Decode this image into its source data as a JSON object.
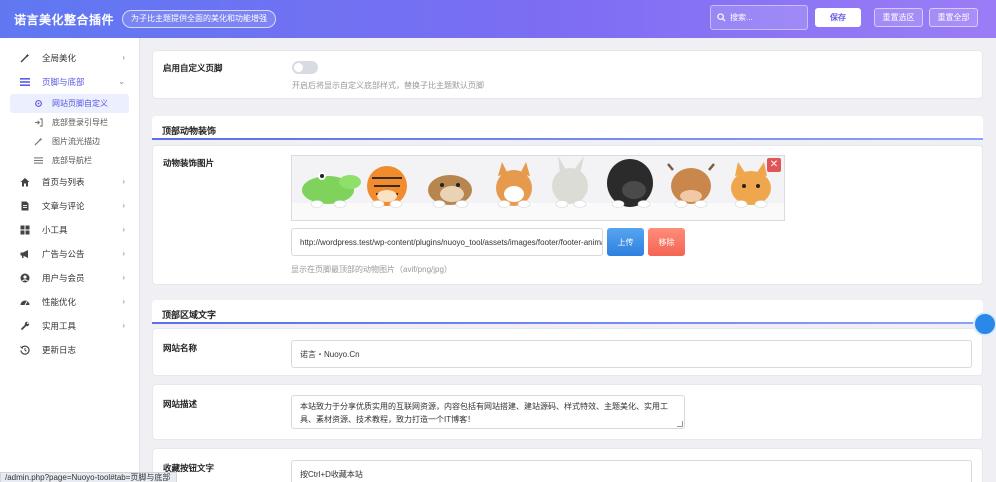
{
  "header": {
    "title": "诺言美化整合插件",
    "tagline": "为子比主题提供全面的美化和功能增强",
    "search_placeholder": "搜索...",
    "save_label": "保存",
    "reset_section_label": "重置选区",
    "reset_all_label": "重置全部"
  },
  "sidebar": {
    "items": [
      {
        "label": "全局美化",
        "icon": "wand-icon"
      },
      {
        "label": "页脚与底部",
        "icon": "list-icon"
      },
      {
        "label": "首页与列表",
        "icon": "home-icon"
      },
      {
        "label": "文章与评论",
        "icon": "document-icon"
      },
      {
        "label": "小工具",
        "icon": "grid-icon"
      },
      {
        "label": "广告与公告",
        "icon": "megaphone-icon"
      },
      {
        "label": "用户与会员",
        "icon": "user-icon"
      },
      {
        "label": "性能优化",
        "icon": "dashboard-icon"
      },
      {
        "label": "实用工具",
        "icon": "wrench-icon"
      },
      {
        "label": "更新日志",
        "icon": "history-icon"
      }
    ],
    "sub_items": [
      {
        "label": "网站页脚自定义",
        "icon": "gear-icon"
      },
      {
        "label": "底部登录引导栏",
        "icon": "login-icon"
      },
      {
        "label": "图片流光描边",
        "icon": "wand-icon"
      },
      {
        "label": "底部导航栏",
        "icon": "menu-icon"
      }
    ]
  },
  "main": {
    "custom_footer": {
      "label": "启用自定义页脚",
      "hint": "开启后将显示自定义底部样式，替换子比主题默认页脚",
      "enabled": false
    },
    "animal_section": {
      "title": "顶部动物装饰",
      "image_label": "动物装饰图片",
      "url": "http://wordpress.test/wp-content/plugins/nuoyo_tool/assets/images/footer/footer-animals.png",
      "upload_label": "上传",
      "remove_label": "移除",
      "hint": "显示在页脚最顶部的动物图片（avif/png/jpg）"
    },
    "text_section": {
      "title": "顶部区域文字",
      "site_name_label": "网站名称",
      "site_name_value": "诺言・Nuoyo.Cn",
      "site_desc_label": "网站描述",
      "site_desc_value": "本站致力于分享优质实用的互联网资源，内容包括有网站搭建、建站源码、样式特效、主题美化、实用工具、素材资源、技术教程，致力打造一个IT博客！",
      "bookmark_label": "收藏按钮文字",
      "bookmark_value": "按Ctrl+D收藏本站"
    }
  },
  "statusbar": {
    "url": "/admin.php?page=Nuoyo-tool#tab=页脚与底部"
  }
}
